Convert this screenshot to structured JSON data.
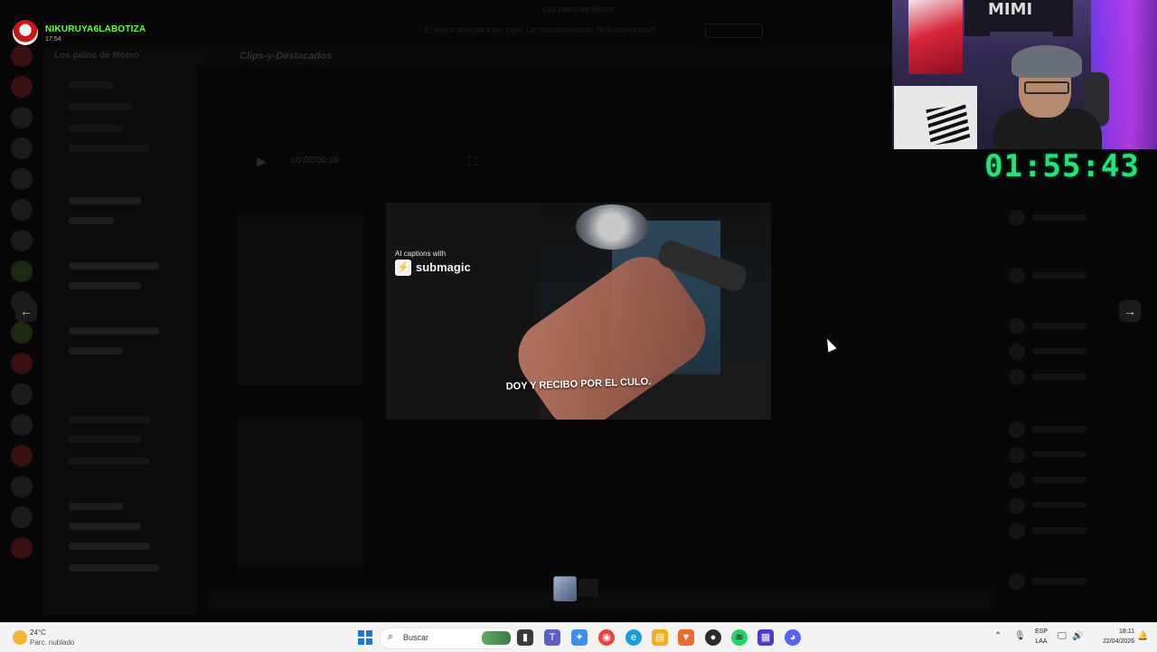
{
  "window": {
    "title": "Los patos de Momo"
  },
  "overlay": {
    "username": "NIKURUYA6LABOTIZA",
    "time": "17:54",
    "timer": "01:55:43"
  },
  "discord_bg": {
    "server_name": "Los patos de Momo",
    "channel_title": "Clips-y-Destacados",
    "banner_text": "El mejor sitio para ver clips, Lo más destacado de la comunidad",
    "video_time": "00:02/00:19"
  },
  "webcam": {
    "sign": "MIMI"
  },
  "viewer": {
    "ai_captions_label": "AI captions with",
    "brand": "submagic",
    "caption": "DOY Y RECIBO POR EL CULO.",
    "prev_label": "←",
    "next_label": "→"
  },
  "taskbar": {
    "weather_temp": "24°C",
    "weather_desc": "Parc. nublado",
    "search_placeholder": "Buscar",
    "lang_top": "ESP",
    "lang_bottom": "LAA",
    "clock_time": "18:11",
    "clock_date": "22/04/2026"
  }
}
